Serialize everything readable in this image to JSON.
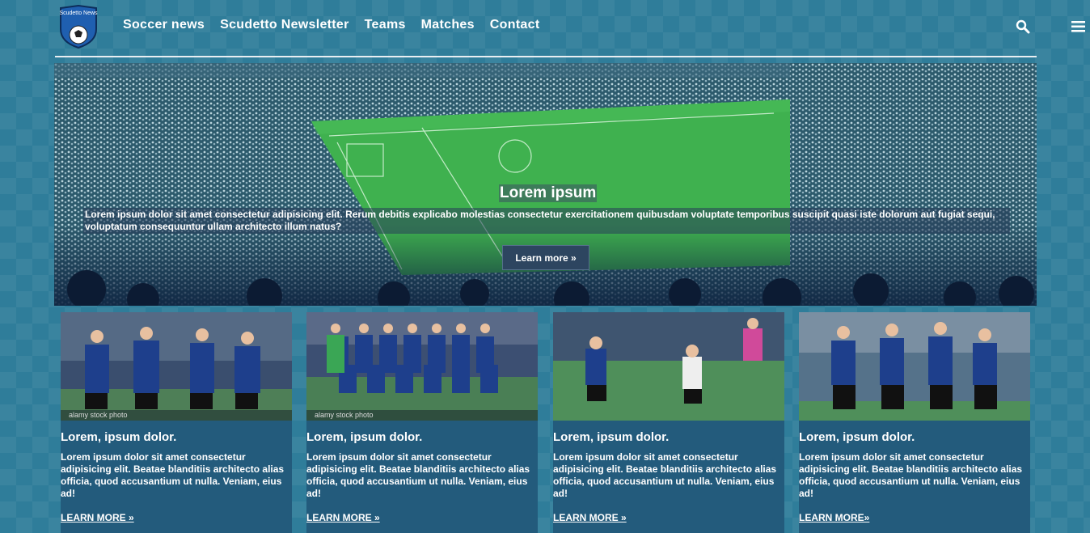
{
  "brand": {
    "logo_text": "Scudetto News"
  },
  "nav": {
    "items": [
      "Soccer news",
      "Scudetto Newsletter",
      "Teams",
      "Matches",
      "Contact"
    ],
    "search_icon": "search-icon",
    "menu_icon": "hamburger-icon"
  },
  "hero": {
    "title": "Lorem ipsum",
    "text": "Lorem ipsum dolor sit amet consectetur adipisicing elit. Rerum debitis explicabo molestias consectetur exercitationem quibusdam voluptate temporibus suscipit quasi iste dolorum aut fugiat sequi, voluptatum consequuntur ullam architecto illum natus?",
    "button": "Learn more »"
  },
  "cards": [
    {
      "title": "Lorem, ipsum dolor.",
      "watermark": "alamy stock photo",
      "text": "Lorem ipsum dolor sit amet consectetur adipisicing elit. Beatae blanditiis architecto alias officia, quod accusantium ut nulla. Veniam, eius ad!",
      "link": "LEARN MORE »"
    },
    {
      "title": "Lorem, ipsum dolor.",
      "watermark": "alamy stock photo",
      "text": "Lorem ipsum dolor sit amet consectetur adipisicing elit. Beatae blanditiis architecto alias officia, quod accusantium ut nulla. Veniam, eius ad!",
      "link": "LEARN MORE »"
    },
    {
      "title": "Lorem, ipsum dolor.",
      "watermark": "",
      "text": "Lorem ipsum dolor sit amet consectetur adipisicing elit. Beatae blanditiis architecto alias officia, quod accusantium ut nulla. Veniam, eius ad!",
      "link": "LEARN MORE »"
    },
    {
      "title": "Lorem, ipsum dolor.",
      "watermark": "",
      "text": "Lorem ipsum dolor sit amet consectetur adipisicing elit. Beatae blanditiis architecto alias officia, quod accusantium ut nulla. Veniam, eius ad!",
      "link": "LEARN MORE»"
    }
  ],
  "colors": {
    "background": "#2f7d9a",
    "card": "#235b7c",
    "pitch": "#3fb14f",
    "kit": "#1e3f8c"
  }
}
